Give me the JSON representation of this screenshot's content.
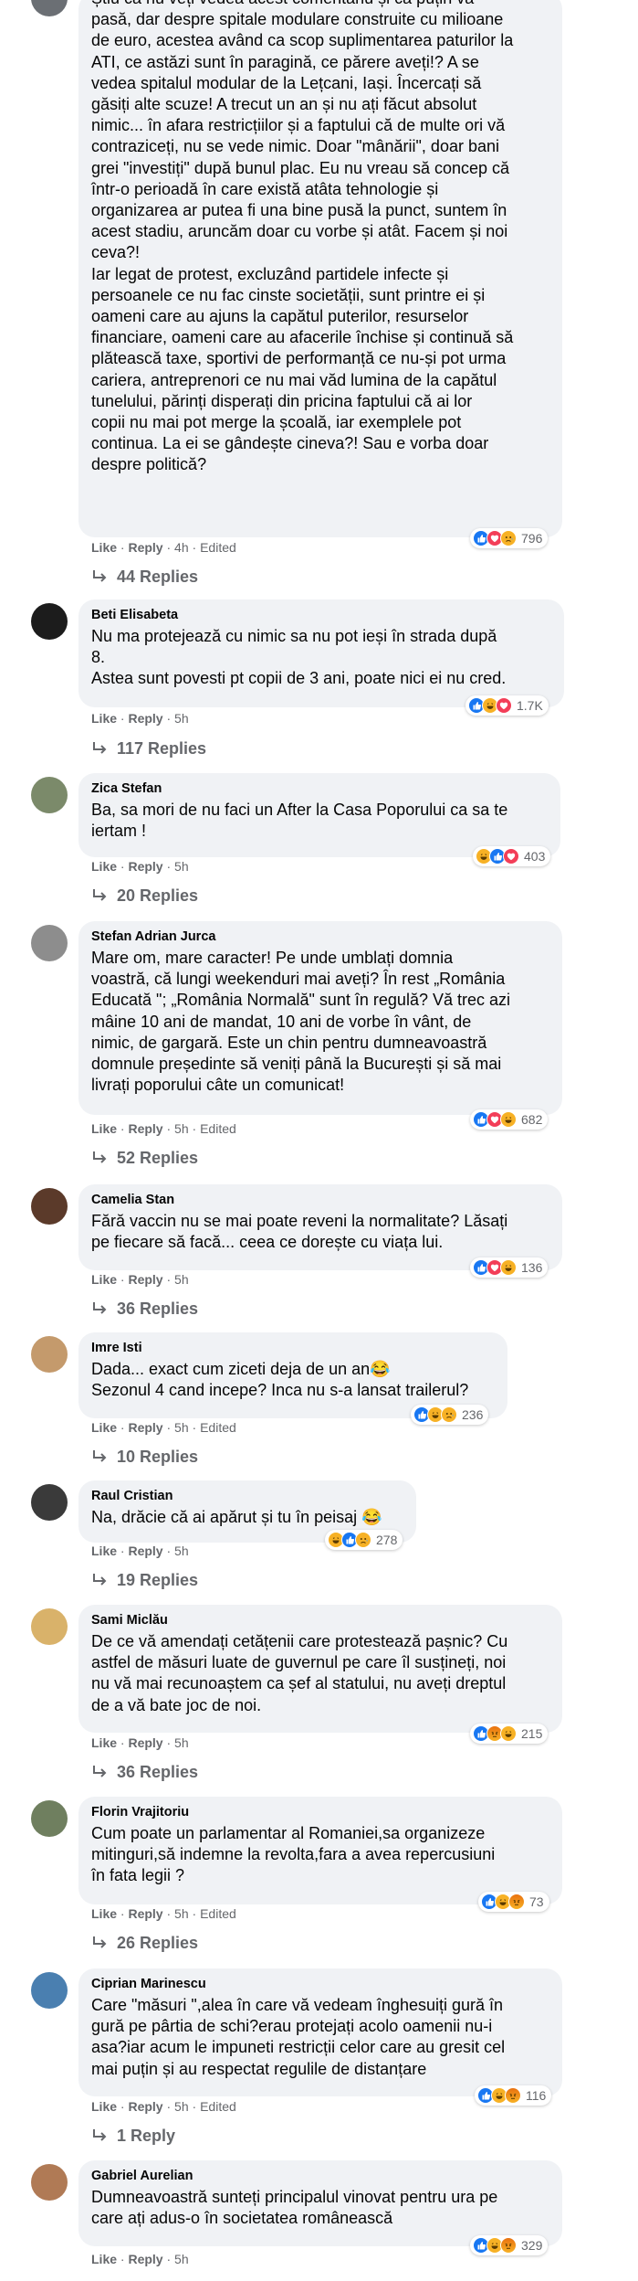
{
  "action_labels": {
    "like": "Like",
    "reply": "Reply",
    "edited": "Edited",
    "dot": "·"
  },
  "comments": [
    {
      "author": "",
      "text": "Știu că nu veți vedea acest comentariu și că puțin vă\npasă, dar despre spitale modulare construite cu milioane\nde euro, acestea având ca scop suplimentarea paturilor la\nATI, ce astăzi sunt în paragină, ce părere aveți!? A se\nvedea spitalul modular de la Lețcani, Iași. Încercați să\ngăsiți alte scuze! A trecut un an și nu ați făcut absolut\nnimic... în afara restricțiilor și a faptului că de multe ori vă\ncontraziceți, nu se vede nimic. Doar \"mânării\", doar bani\ngrei \"investiți\" după bunul plac. Eu nu vreau să concep că\nîntr-o perioadă în care există atâta tehnologie și\norganizarea ar putea fi una bine pusă la punct, suntem în\nacest stadiu, aruncăm doar cu vorbe și atât. Facem și noi\nceva?!\nIar legat de protest, excluzând partidele infecte și\npersoanele ce nu fac cinste societății, sunt printre ei și\noameni care au ajuns la capătul puterilor, resurselor\nfinanciare, oameni care au afacerile închise și continuă să\nplătească taxe, sportivi de performanță ce nu-și pot urma\ncariera, antreprenori ce nu mai văd lumina de la capătul\ntunelului, părinți disperați din pricina faptului că ai lor\ncopii nu mai pot merge la școală, iar exemplele pot\ncontinua. La ei se gândește cineva?! Sau e vorba doar\ndespre politică?",
      "time": "4h",
      "edited": true,
      "reactions": [
        "like",
        "love",
        "sad"
      ],
      "count": "796",
      "replies": "44 Replies",
      "avatar_color": "#6b6f74"
    },
    {
      "author": "Beti Elisabeta",
      "text": "Nu ma protejează cu nimic sa nu pot ieși în strada după\n8.\nAstea sunt povesti pt copii de 3 ani, poate nici ei nu cred.",
      "time": "5h",
      "edited": false,
      "reactions": [
        "like",
        "haha",
        "love"
      ],
      "count": "1.7K",
      "replies": "117 Replies",
      "avatar_color": "#1c1c1c"
    },
    {
      "author": "Zica Stefan",
      "text": "Ba, sa mori de nu faci un After la Casa Poporului ca sa te\niertam !",
      "time": "5h",
      "edited": false,
      "reactions": [
        "haha",
        "like",
        "love"
      ],
      "count": "403",
      "replies": "20 Replies",
      "avatar_color": "#7b8a6a"
    },
    {
      "author": "Stefan Adrian Jurca",
      "text": "Mare om, mare caracter! Pe unde umblați domnia\nvoastră, că lungi weekenduri mai aveți? În rest „România\nEducată \"; „România Normală\" sunt în regulă? Vă trec azi\nmâine 10 ani de mandat, 10 ani de vorbe în vânt, de\nnimic, de gargară. Este un chin pentru dumneavoastră\ndomnule președinte să veniți până la București și să mai\nlivrați poporului câte un comunicat!",
      "time": "5h",
      "edited": true,
      "reactions": [
        "like",
        "love",
        "haha"
      ],
      "count": "682",
      "replies": "52 Replies",
      "avatar_color": "#8d8d8d"
    },
    {
      "author": "Camelia Stan",
      "text": "Fără vaccin nu se mai poate reveni la normalitate? Lăsați\npe fiecare să facă... ceea ce dorește cu viața lui.",
      "time": "5h",
      "edited": false,
      "reactions": [
        "like",
        "love",
        "haha"
      ],
      "count": "136",
      "replies": "36 Replies",
      "avatar_color": "#5b3a2a"
    },
    {
      "author": "Imre Isti",
      "text": "Dada... exact cum ziceti deja de un an😂\nSezonul 4 cand incepe? Inca nu s-a lansat trailerul?",
      "time": "5h",
      "edited": true,
      "reactions": [
        "like",
        "haha",
        "sad"
      ],
      "count": "236",
      "replies": "10 Replies",
      "avatar_color": "#c49a6c"
    },
    {
      "author": "Raul Cristian",
      "text": "Na, drăcie că ai apărut și tu în peisaj 😂",
      "time": "5h",
      "edited": false,
      "reactions": [
        "haha",
        "like",
        "sad"
      ],
      "count": "278",
      "replies": "19 Replies",
      "avatar_color": "#3a3a3a"
    },
    {
      "author": "Sami Miclău",
      "text": "De ce vă amendați cetățenii care protestează pașnic? Cu\nastfel de măsuri luate de guvernul pe care îl susțineți, noi\nnu vă mai recunoaștem ca șef al statului, nu aveți dreptul\nde a vă bate joc de noi.",
      "time": "5h",
      "edited": false,
      "reactions": [
        "like",
        "angry",
        "haha"
      ],
      "count": "215",
      "replies": "36 Replies",
      "avatar_color": "#d9b26a"
    },
    {
      "author": "Florin Vrajitoriu",
      "text": "Cum poate un parlamentar al Romaniei,sa organizeze\nmitinguri,să indemne la revolta,fara a avea repercusiuni\nîn fata legii ?",
      "time": "5h",
      "edited": true,
      "reactions": [
        "like",
        "haha",
        "angry"
      ],
      "count": "73",
      "replies": "26 Replies",
      "avatar_color": "#6f7f5f"
    },
    {
      "author": "Ciprian Marinescu",
      "text": "Care \"măsuri \",alea în care vă vedeam înghesuiți gură în\ngură pe pârtia de schi?erau protejați acolo oamenii nu-i\nasa?iar acum le impuneti restricții celor care au gresit cel\nmai puțin și au respectat regulile de distanțare",
      "time": "5h",
      "edited": true,
      "reactions": [
        "like",
        "haha",
        "angry"
      ],
      "count": "116",
      "replies": "1 Reply",
      "avatar_color": "#4a7fb0"
    },
    {
      "author": "Gabriel Aurelian",
      "text": "Dumneavoastră sunteți principalul vinovat pentru ura pe\ncare ați adus-o în societatea românească",
      "time": "5h",
      "edited": false,
      "reactions": [
        "like",
        "haha",
        "angry"
      ],
      "count": "329",
      "replies": "",
      "avatar_color": "#b07a55"
    }
  ]
}
